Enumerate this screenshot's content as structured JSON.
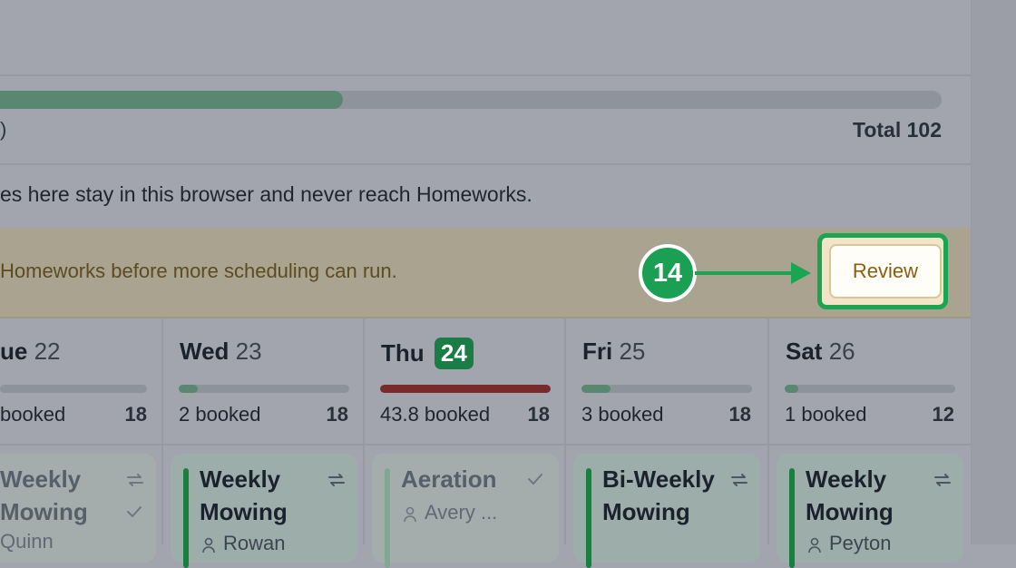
{
  "progress": {
    "fill_fraction": 0.37,
    "caption": ")",
    "total_label": "Total 102",
    "colors": {
      "fill": "#598770",
      "track": "#8f939c"
    }
  },
  "local_note": "es here stay in this browser and never reach Homeworks.",
  "banner": {
    "message": "Homeworks before more scheduling can run.",
    "review_label": "Review",
    "step_number": "14",
    "colors": {
      "highlight": "#19a552",
      "text": "#5c4b23"
    }
  },
  "days": [
    {
      "name": "ue",
      "date": "22",
      "booked": "booked",
      "capacity": "18",
      "load_fraction": 0.0,
      "bar_color": "#598770"
    },
    {
      "name": "Wed",
      "date": "23",
      "booked": "2 booked",
      "capacity": "18",
      "load_fraction": 0.11,
      "bar_color": "#598770"
    },
    {
      "name": "Thu",
      "date": "24",
      "booked": "43.8 booked",
      "capacity": "18",
      "load_fraction": 1.0,
      "bar_color": "#7a2a2a",
      "today": true
    },
    {
      "name": "Fri",
      "date": "25",
      "booked": "3 booked",
      "capacity": "18",
      "load_fraction": 0.17,
      "bar_color": "#598770"
    },
    {
      "name": "Sat",
      "date": "26",
      "booked": "1 booked",
      "capacity": "12",
      "load_fraction": 0.08,
      "bar_color": "#598770"
    }
  ],
  "cards": [
    {
      "title": "Weekly Mowing",
      "assignee": "Quinn",
      "done": true
    },
    {
      "title": "Weekly Mowing",
      "assignee": "Rowan",
      "done": false
    },
    {
      "title": "Aeration",
      "assignee": "Avery ...",
      "done": true
    },
    {
      "title": "Bi-Weekly Mowing",
      "assignee": "",
      "done": false
    },
    {
      "title": "Weekly Mowing",
      "assignee": "Peyton",
      "done": false
    }
  ]
}
